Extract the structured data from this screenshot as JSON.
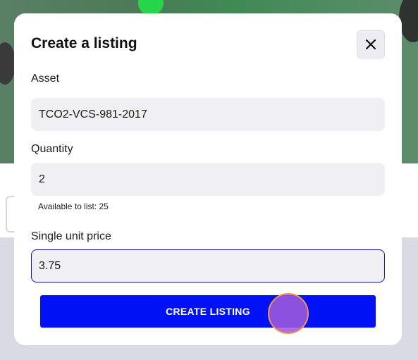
{
  "modal": {
    "title": "Create a listing",
    "close_icon": "close-icon",
    "asset_label": "Asset",
    "asset_value": "TCO2-VCS-981-2017",
    "quantity_label": "Quantity",
    "quantity_value": "2",
    "available_hint": "Available to list: 25",
    "price_label": "Single unit price",
    "price_value": "3.75",
    "submit_label": "CREATE LISTING"
  },
  "colors": {
    "accent": "#0012f5",
    "focus_border": "#0c1aa6",
    "field_bg": "#efeff4",
    "cursor": "#a05adc"
  }
}
